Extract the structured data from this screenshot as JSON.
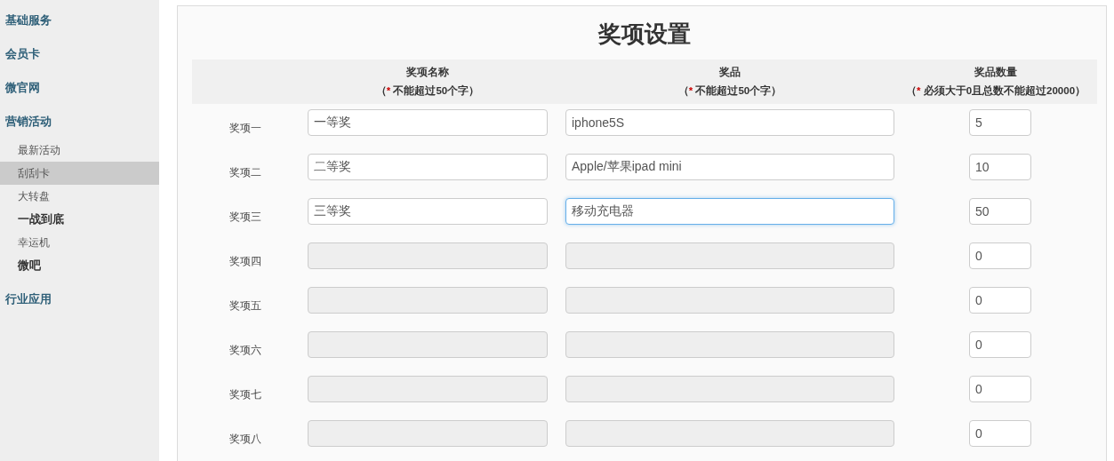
{
  "sidebar": {
    "items": [
      {
        "label": "基础服务",
        "kind": "section",
        "selected": false
      },
      {
        "label": "会员卡",
        "kind": "section",
        "selected": false
      },
      {
        "label": "微官网",
        "kind": "section",
        "selected": false
      },
      {
        "label": "营销活动",
        "kind": "section",
        "selected": false
      },
      {
        "label": "最新活动",
        "kind": "item",
        "selected": false
      },
      {
        "label": "刮刮卡",
        "kind": "item",
        "selected": true
      },
      {
        "label": "大转盘",
        "kind": "item",
        "selected": false
      },
      {
        "label": "一战到底",
        "kind": "item-strong",
        "selected": false
      },
      {
        "label": "幸运机",
        "kind": "item",
        "selected": false
      },
      {
        "label": "微吧",
        "kind": "item-strong",
        "selected": false
      },
      {
        "label": "行业应用",
        "kind": "section",
        "selected": false
      }
    ]
  },
  "panel": {
    "title": "奖项设置",
    "columns": [
      {
        "title": "奖项名称",
        "open": "（",
        "mark": "*",
        "note": "不能超过50个字）"
      },
      {
        "title": "奖品",
        "open": "（",
        "mark": "*",
        "note": "不能超过50个字）"
      },
      {
        "title": "奖品数量",
        "open": "（",
        "mark": "*",
        "note": "必须大于0且总数不能超过20000）"
      }
    ],
    "rows": [
      {
        "label": "奖项一",
        "name": "一等奖",
        "prize": "iphone5S",
        "quantity": "5",
        "disabled": false,
        "focused": false
      },
      {
        "label": "奖项二",
        "name": "二等奖",
        "prize": "Apple/苹果ipad mini",
        "quantity": "10",
        "disabled": false,
        "focused": false
      },
      {
        "label": "奖项三",
        "name": "三等奖",
        "prize": "移动充电器",
        "quantity": "50",
        "disabled": false,
        "focused": true
      },
      {
        "label": "奖项四",
        "quantity": "0",
        "disabled": true,
        "focused": false
      },
      {
        "label": "奖项五",
        "quantity": "0",
        "disabled": true,
        "focused": false
      },
      {
        "label": "奖项六",
        "quantity": "0",
        "disabled": true,
        "focused": false
      },
      {
        "label": "奖项七",
        "quantity": "0",
        "disabled": true,
        "focused": false
      },
      {
        "label": "奖项八",
        "quantity": "0",
        "disabled": true,
        "focused": false
      }
    ]
  }
}
